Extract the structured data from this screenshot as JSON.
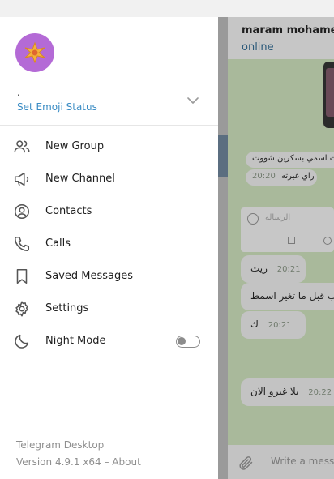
{
  "chat": {
    "contact_name": "maram mohamed",
    "status": "online",
    "messages": [
      {
        "text": "بعد ما سويت اسمي بسكرين شووت",
        "time": ""
      },
      {
        "text": "بس راي غيرته",
        "time": "‏20:20"
      },
      {
        "text": "ريت",
        "time": "20:21"
      },
      {
        "text": "يب قبل ما تغير اسمط",
        "time": ""
      },
      {
        "text": "ك",
        "time": "20:21"
      },
      {
        "text": "يلا غيرو الان",
        "time": "20:22"
      }
    ],
    "composer_placeholder": "الرسالة",
    "write_placeholder": "Write a message..."
  },
  "drawer": {
    "profile_name": ".",
    "emoji_status_label": "Set Emoji Status",
    "menu": [
      {
        "label": "New Group",
        "icon": "group-icon"
      },
      {
        "label": "New Channel",
        "icon": "megaphone-icon"
      },
      {
        "label": "Contacts",
        "icon": "contact-icon"
      },
      {
        "label": "Calls",
        "icon": "phone-icon"
      },
      {
        "label": "Saved Messages",
        "icon": "bookmark-icon"
      },
      {
        "label": "Settings",
        "icon": "gear-icon"
      },
      {
        "label": "Night Mode",
        "icon": "moon-icon",
        "toggle": false
      }
    ],
    "footer_app": "Telegram Desktop",
    "footer_version": "Version 4.9.1 x64 – ",
    "footer_about": "About"
  },
  "colors": {
    "accent": "#3a8cc4",
    "avatar": "#b46ad6",
    "text": "#1d1d1d",
    "muted": "#8f8f8f"
  }
}
